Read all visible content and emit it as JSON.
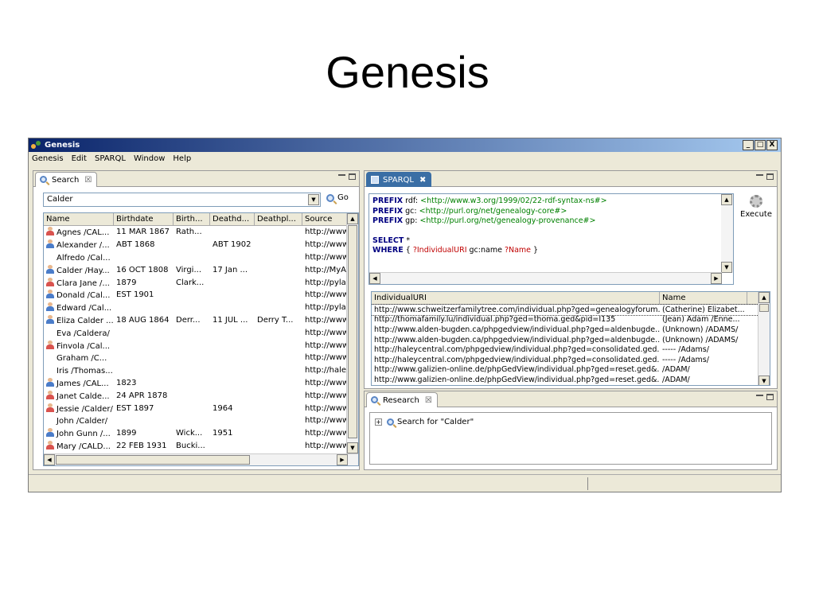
{
  "slide_title": "Genesis",
  "window": {
    "title": "Genesis",
    "btn_min": "_",
    "btn_max": "□",
    "btn_close": "X"
  },
  "menu": [
    "Genesis",
    "Edit",
    "SPARQL",
    "Window",
    "Help"
  ],
  "search_panel": {
    "tab_label": "Search",
    "tab_close": "☒",
    "query_value": "Calder",
    "go_label": "Go",
    "columns": [
      "Name",
      "Birthdate",
      "Birth...",
      "Deathd...",
      "Deathpl...",
      "Source"
    ],
    "rows": [
      {
        "icon": "female",
        "cells": [
          "Agnes /CAL...",
          "11 MAR 1867",
          "Rath...",
          "",
          "",
          "http://www"
        ]
      },
      {
        "icon": "male",
        "cells": [
          "Alexander /...",
          "ABT 1868",
          "",
          "ABT 1902",
          "",
          "http://www"
        ]
      },
      {
        "icon": "none",
        "cells": [
          "Alfredo /Cal...",
          "",
          "",
          "",
          "",
          "http://www"
        ]
      },
      {
        "icon": "male",
        "cells": [
          "Calder /Hay...",
          "16 OCT 1808",
          "Virgi...",
          "17 Jan ...",
          "",
          "http://MyA"
        ]
      },
      {
        "icon": "female",
        "cells": [
          "Clara Jane /...",
          "1879",
          "Clark...",
          "",
          "",
          "http://pylar"
        ]
      },
      {
        "icon": "male",
        "cells": [
          "Donald /Cal...",
          "EST 1901",
          "",
          "",
          "",
          "http://www"
        ]
      },
      {
        "icon": "male",
        "cells": [
          "Edward /Cal...",
          "",
          "",
          "",
          "",
          "http://pylar"
        ]
      },
      {
        "icon": "male",
        "cells": [
          "Eliza Calder ...",
          "18 AUG 1864",
          "Derr...",
          "11 JUL ...",
          "Derry T...",
          "http://www"
        ]
      },
      {
        "icon": "none",
        "cells": [
          "Eva /Caldera/",
          "",
          "",
          "",
          "",
          "http://www"
        ]
      },
      {
        "icon": "female",
        "cells": [
          "Finvola /Cal...",
          "",
          "",
          "",
          "",
          "http://www"
        ]
      },
      {
        "icon": "none",
        "cells": [
          "Graham /C...",
          "",
          "",
          "",
          "",
          "http://www"
        ]
      },
      {
        "icon": "none",
        "cells": [
          "Iris /Thomas...",
          "",
          "",
          "",
          "",
          "http://haley"
        ]
      },
      {
        "icon": "male",
        "cells": [
          "James /CAL...",
          "1823",
          "",
          "",
          "",
          "http://www"
        ]
      },
      {
        "icon": "female",
        "cells": [
          "Janet Calde...",
          "24 APR 1878",
          "",
          "",
          "",
          "http://www"
        ]
      },
      {
        "icon": "female",
        "cells": [
          "Jessie /Calder/",
          "EST 1897",
          "",
          "1964",
          "",
          "http://www"
        ]
      },
      {
        "icon": "none",
        "cells": [
          "John /Calder/",
          "",
          "",
          "",
          "",
          "http://www"
        ]
      },
      {
        "icon": "male",
        "cells": [
          "John Gunn /...",
          "1899",
          "Wick...",
          "1951",
          "",
          "http://www"
        ]
      },
      {
        "icon": "female",
        "cells": [
          "Mary /CALD...",
          "22 FEB 1931",
          "Bucki...",
          "",
          "",
          "http://www"
        ]
      }
    ]
  },
  "sparql_panel": {
    "tab_label": "SPARQL",
    "tab_close": "✖",
    "execute_label": "Execute",
    "query_lines": [
      {
        "kw": "PREFIX",
        "pfx": " rdf: ",
        "uri": "<http://www.w3.org/1999/02/22-rdf-syntax-ns#>"
      },
      {
        "kw": "PREFIX",
        "pfx": " gc: ",
        "uri": "<http://purl.org/net/genealogy-core#>"
      },
      {
        "kw": "PREFIX",
        "pfx": " gp: ",
        "uri": "<http://purl.org/net/genealogy-provenance#>"
      }
    ],
    "select_kw": "SELECT",
    "select_rest": " *",
    "where_kw": "WHERE",
    "where_open": " { ",
    "where_var1": "?IndividualURI",
    "where_mid": " gc:name ",
    "where_var2": "?Name",
    "where_close": " }",
    "result_columns": [
      "IndividualURI",
      "Name"
    ],
    "results": [
      [
        "http://www.schweitzerfamilytree.com/individual.php?ged=genealogyforum....",
        "(Catherine) Elizabet..."
      ],
      [
        "http://thomafamily.lu/individual.php?ged=thoma.ged&pid=I135",
        "(Jean) Adam /Enne..."
      ],
      [
        "http://www.alden-bugden.ca/phpgedview/individual.php?ged=aldenbugde...",
        "(Unknown) /ADAMS/"
      ],
      [
        "http://www.alden-bugden.ca/phpgedview/individual.php?ged=aldenbugde...",
        "(Unknown) /ADAMS/"
      ],
      [
        "http://haleycentral.com/phpgedview/individual.php?ged=consolidated.ged...",
        "----- /Adams/"
      ],
      [
        "http://haleycentral.com/phpgedview/individual.php?ged=consolidated.ged...",
        "----- /Adams/"
      ],
      [
        "http://www.galizien-online.de/phpGedView/individual.php?ged=reset.ged&...",
        "/ADAM/"
      ],
      [
        "http://www.galizien-online.de/phpGedView/individual.php?ged=reset.ged&...",
        "/ADAM/"
      ]
    ]
  },
  "research_panel": {
    "tab_label": "Research",
    "tab_close": "☒",
    "tree_item": "Search for \"Calder\""
  }
}
